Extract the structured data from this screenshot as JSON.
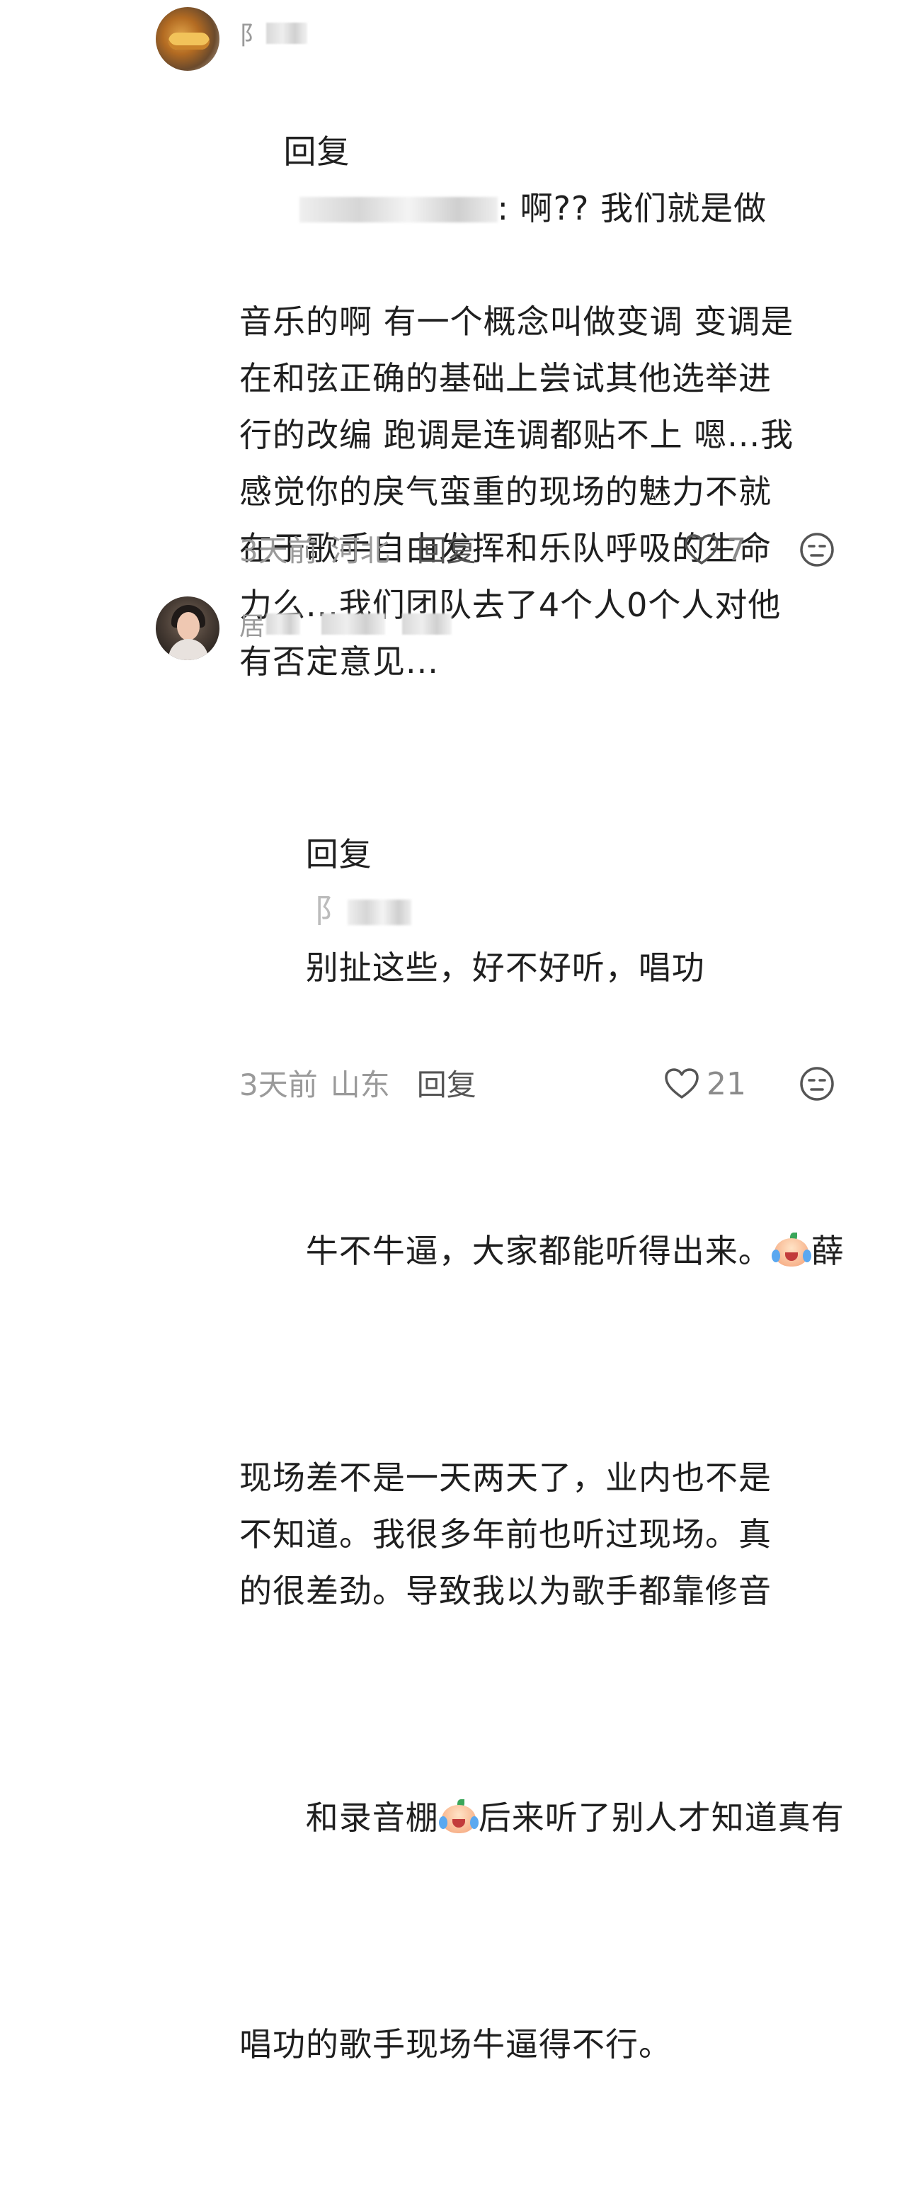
{
  "comments": [
    {
      "username_visible_char": "阝",
      "reply_prefix": "回复",
      "reply_tail": ": 啊?? 我们就是做",
      "reply_text": "音乐的啊 有一个概念叫做变调 变调是\n在和弦正确的基础上尝试其他选举进\n行的改编 跑调是连调都贴不上 嗯...我\n感觉你的戾气蛮重的现场的魅力不就\n在于歌手自由发挥和乐队呼吸的生命\n力么...我们团队去了4个人0个人对他\n有否定意见...",
      "time": "3天前",
      "location": "河北",
      "reply_button": "回复",
      "likes": "7",
      "avatar_icon": "food-photo-avatar"
    },
    {
      "username_visible_char": "居",
      "reply_prefix": "回复",
      "reply_visible_char": "阝",
      "reply_line1_tail": "别扯这些，好不好听，唱功",
      "reply_line2": "牛不牛逼，大家都能听得出来。",
      "reply_line2_tail": "薛",
      "reply_middle": "现场差不是一天两天了，业内也不是\n不知道。我很多年前也听过现场。真\n的很差劲。导致我以为歌手都靠修音",
      "reply_line6_head": "和录音棚",
      "reply_line6_tail": "后来听了别人才知道真有",
      "reply_line7": "唱功的歌手现场牛逼得不行。",
      "time": "3天前",
      "location": "山东",
      "reply_button": "回复",
      "likes": "21",
      "avatar_icon": "woman-portrait-avatar",
      "emoji_icon": "crying-peach-emoji"
    }
  ]
}
